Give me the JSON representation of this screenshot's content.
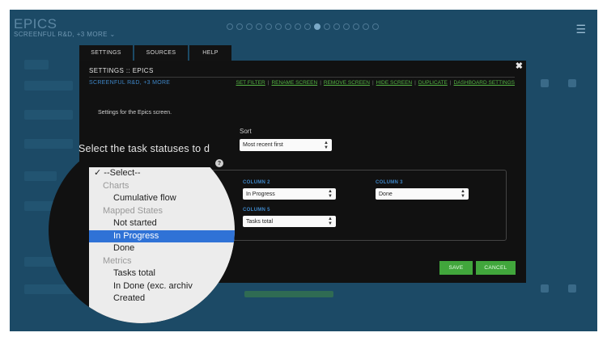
{
  "app": {
    "title": "EPICS",
    "subtitle": "SCREENFUL R&D, +3 MORE ⌄"
  },
  "pager": {
    "count": 16,
    "active_index": 9
  },
  "tabs": [
    {
      "label": "SETTINGS"
    },
    {
      "label": "SOURCES"
    },
    {
      "label": "HELP"
    }
  ],
  "modal": {
    "title": "SETTINGS :: EPICS",
    "close": "✖",
    "subtitle": "SCREENFUL R&D, +3 MORE",
    "links": [
      "SET FILTER",
      "RENAME SCREEN",
      "REMOVE SCREEN",
      "HIDE SCREEN",
      "DUPLICATE",
      "DASHBOARD SETTINGS"
    ],
    "description": "Settings for the Epics screen.",
    "sort": {
      "label": "Sort",
      "value": "Most recent first"
    },
    "columns": {
      "col2": {
        "label": "COLUMN 2",
        "value": "In Progress"
      },
      "col3": {
        "label": "COLUMN 3",
        "value": "Done"
      },
      "col5": {
        "label": "COLUMN 5",
        "value": "Tasks total"
      }
    },
    "save": "SAVE",
    "cancel": "CANCEL"
  },
  "magnifier": {
    "label": "Select the task statuses to d",
    "help": "?",
    "options": [
      {
        "text": "--Select--",
        "kind": "selected",
        "check": "✓"
      },
      {
        "text": "Charts",
        "kind": "group"
      },
      {
        "text": "Cumulative flow",
        "kind": "item"
      },
      {
        "text": "Mapped States",
        "kind": "group"
      },
      {
        "text": "Not started",
        "kind": "item"
      },
      {
        "text": "In Progress",
        "kind": "highlighted"
      },
      {
        "text": "Done",
        "kind": "item"
      },
      {
        "text": "Metrics",
        "kind": "group"
      },
      {
        "text": "Tasks total",
        "kind": "item"
      },
      {
        "text": "In Done (exc. archiv",
        "kind": "item"
      },
      {
        "text": "Created",
        "kind": "item"
      }
    ]
  },
  "colors": {
    "background": "#1c4a66",
    "modal": "#111111",
    "accent_link": "#54b443",
    "accent_blue": "#3e86c7",
    "button": "#41a63c",
    "highlight": "#2f72d6"
  },
  "icons": {
    "close": "close-icon",
    "menu": "hamburger-menu-icon",
    "help": "help-icon",
    "check": "checkmark-icon",
    "arrow": "select-arrow-icon"
  }
}
